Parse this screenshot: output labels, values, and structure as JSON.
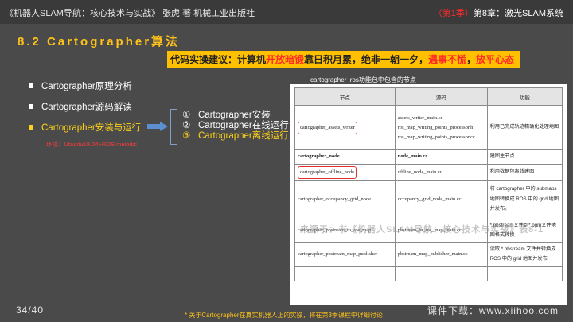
{
  "header": {
    "book_title": "《机器人SLAM导航：核心技术与实战》   张虎 著    机械工业出版社",
    "season": "（第1季）",
    "chapter": "第8章：激光SLAM系统"
  },
  "section_title": "8.2 Cartographer算法",
  "advice": {
    "label": "代码实操建议：",
    "text_a": "计算机",
    "highlight_1": "开放暗锻",
    "text_b": "靠日积月累，绝非一朝一夕，",
    "highlight_2": "遇事不慌",
    "text_c": "，",
    "highlight_3": "放平心态"
  },
  "menu": [
    {
      "label": "Cartographer原理分析"
    },
    {
      "label": "Cartographer源码解读"
    },
    {
      "label": "Cartographer安装与运行"
    }
  ],
  "env_note": "环境：Ubuntu18.04+ROS melodic",
  "steps": [
    {
      "num": "①",
      "label": "Cartographer安装"
    },
    {
      "num": "②",
      "label": "Cartographer在线运行"
    },
    {
      "num": "③",
      "label": "Cartographer离线运行"
    }
  ],
  "table": {
    "caption": "cartographer_ros功能包中包含的节点",
    "headers": [
      "节点",
      "源码",
      "功能"
    ],
    "rows": [
      {
        "node": "cartographer_assets_writer",
        "source": "assets_writer_main.cc\nros_map_writing_points_processor.h\nros_map_writing_points_processor.cc",
        "function": "利用已完成轨迹精确化处理地图"
      },
      {
        "node": "cartographer_node",
        "source": "node_main.cc",
        "function": "建图主节点"
      },
      {
        "node": "cartographer_offline_node",
        "source": "offline_node_main.cc",
        "function": "利用数据包离线建图"
      },
      {
        "node": "cartographer_occupancy_grid_node",
        "source": "occupancy_grid_node_main.cc",
        "function": "将 cartographer 中的 submaps 地图转换成 ROS 中的 grid 地图并发布。"
      },
      {
        "node": "cartographer_pbstream_to_ros_map",
        "source": "pbstream_to_ros_map_main.cc",
        "function": "*.pbstream文件到*.pgm文件地图格式转换"
      },
      {
        "node": "cartographer_pbstream_map_publisher",
        "source": "pbstream_map_publisher_main.cc",
        "function": "读取 *.pbstream 文件并转换成 ROS 中的 grid 地图并发布"
      },
      {
        "node": "...",
        "source": "...",
        "function": "..."
      }
    ]
  },
  "watermark": "来源于：书《机器人SLAM导航：核心技术与实战》表8-1",
  "page_number": "34/40",
  "footnote": "* 关于Cartographer在真实机器人上的实操，将在第3季课程中详细讨论",
  "download": "课件下载：www.xiihoo.com"
}
